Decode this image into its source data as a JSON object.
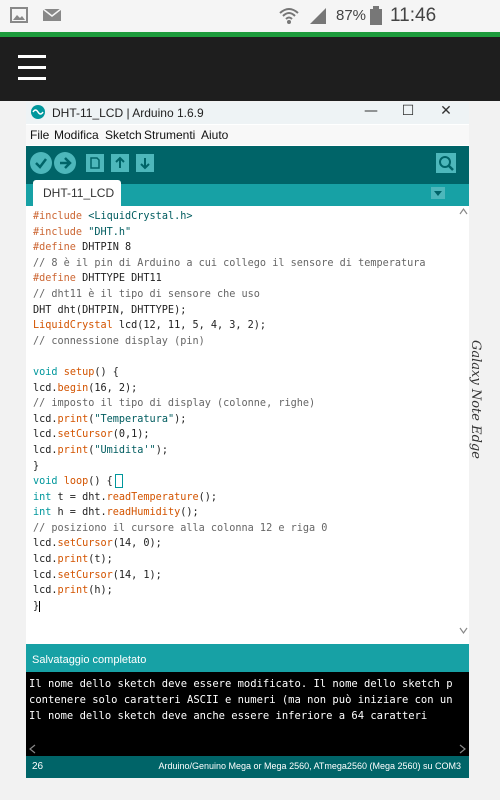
{
  "phone_status": {
    "left_icons": [
      "image-icon",
      "mail-icon"
    ],
    "right_icons": [
      "wifi-icon",
      "signal-icon",
      "battery-icon"
    ],
    "battery": "87%",
    "time": "11:46"
  },
  "side_label": "Galaxy Note Edge",
  "window": {
    "title": "DHT-11_LCD | Arduino 1.6.9",
    "controls": {
      "minimize": "—",
      "maximize": "☐",
      "close": "✕"
    }
  },
  "menu": [
    "File",
    "Modifica",
    "Sketch",
    "Strumenti",
    "Aiuto"
  ],
  "toolbar": {
    "buttons": [
      "verify-icon",
      "upload-icon",
      "new-icon",
      "open-icon",
      "save-icon"
    ],
    "serial_monitor": "serial-monitor-icon"
  },
  "tab": {
    "label": "DHT-11_LCD"
  },
  "code": {
    "include_kw": "#include",
    "include_lib": "<LiquidCrystal.h>",
    "include2": "\"DHT.h\"",
    "define_kw": "#define",
    "define1": " DHTPIN 8",
    "comment1": "// 8 è il pin di Arduino a cui collego il sensore di temperatura",
    "define2": " DHTTYPE DHT11",
    "comment2": "// dht11 è il tipo di sensore che uso",
    "line_dht": "DHT dht(DHTPIN, DHTTYPE);",
    "lc_class": "LiquidCrystal",
    "line_lcd": " lcd(12, 11, 5, 4, 3, 2);",
    "comment3": "// connessione display (pin)",
    "void_kw": "void",
    "setup_fn": "setup",
    "setup_rest": "() {",
    "lcd_obj": "lcd.",
    "begin_fn": "begin",
    "begin_args": "(16, 2);",
    "comment4": "// imposto il tipo di display (colonne, righe)",
    "print_fn": "print",
    "print1_arg": "\"Temperatura\"",
    "setcursor_fn": "setCursor",
    "setcursor1_args": "(0,1);",
    "print2_arg": "\"Umidita'\"",
    "close_brace": "}",
    "loop_fn": "loop",
    "loop_rest": "() {",
    "int_kw": "int",
    "line_t_pre": " t = dht.",
    "readtemp_fn": "readTemperature",
    "empty_call": "();",
    "line_h_pre": " h = dht.",
    "readhum_fn": "readHumidity",
    "comment5": "// posiziono il cursore alla colonna 12 e riga 0",
    "setcursor2_args": "(14, 0);",
    "print_t_args": "(t);",
    "setcursor3_args": "(14, 1);",
    "print_h_args": "(h);"
  },
  "status_message": "Salvataggio completato",
  "console_lines": [
    "Il nome dello sketch deve essere modificato. Il nome dello sketch p",
    "contenere solo caratteri ASCII e numeri (ma non può iniziare con un",
    "Il nome dello sketch deve anche essere inferiore a 64 caratteri"
  ],
  "footer": {
    "line": "26",
    "board": "Arduino/Genuino Mega or Mega 2560, ATmega2560 (Mega 2560) su COM3"
  },
  "colors": {
    "teal_dark": "#006468",
    "teal_light": "#17a1a5",
    "android_green": "#1d9b3c"
  }
}
